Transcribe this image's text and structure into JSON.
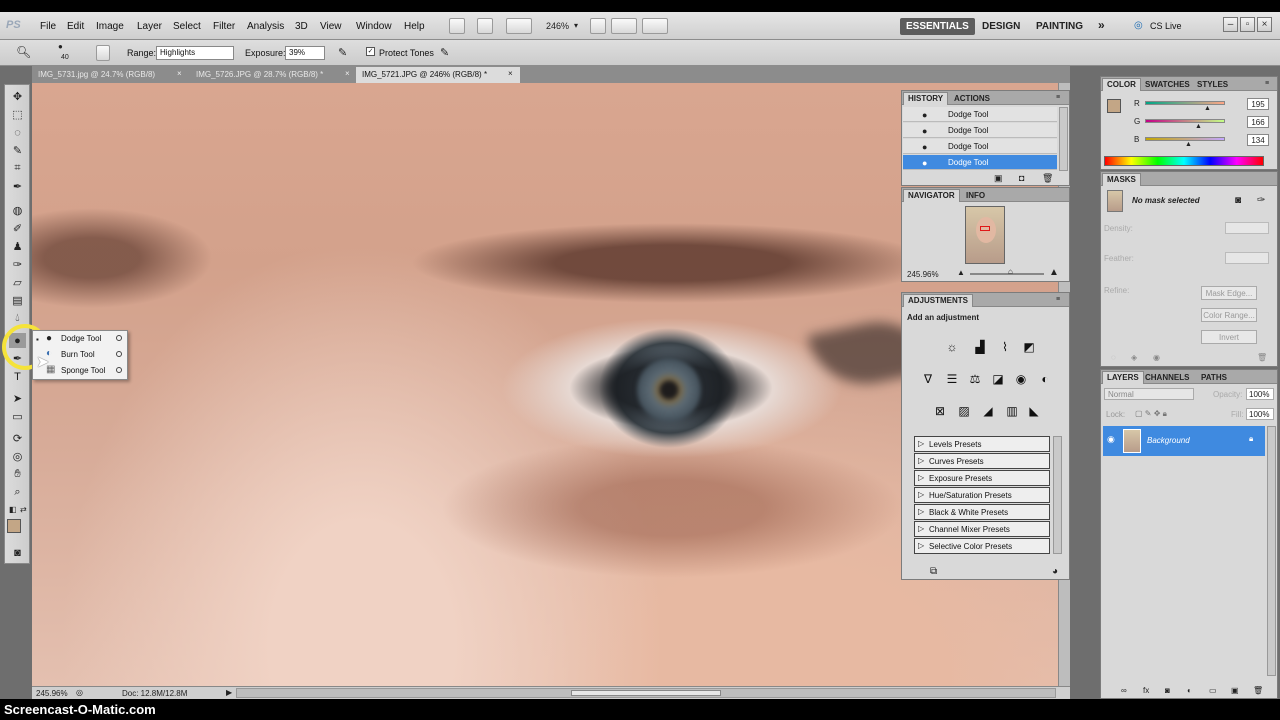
{
  "app": {
    "logo": "PS",
    "watermark": "Screencast-O-Matic.com"
  },
  "menu": [
    "File",
    "Edit",
    "Image",
    "Layer",
    "Select",
    "Filter",
    "Analysis",
    "3D",
    "View",
    "Window",
    "Help"
  ],
  "appbar": {
    "zoom": "246%",
    "workspaces": [
      "ESSENTIALS",
      "DESIGN",
      "PAINTING"
    ],
    "more": "»",
    "cslive": "CS Live"
  },
  "options": {
    "brush_size": "40",
    "range_label": "Range:",
    "range_value": "Highlights",
    "exposure_label": "Exposure:",
    "exposure_value": "39%",
    "protect_tones": "Protect Tones"
  },
  "tabs": [
    "IMG_5731.jpg @ 24.7% (RGB/8)",
    "IMG_5726.JPG @ 28.7% (RGB/8) *",
    "IMG_5721.JPG @ 246% (RGB/8) *"
  ],
  "flyout": [
    "Dodge Tool",
    "Burn Tool",
    "Sponge Tool"
  ],
  "status": {
    "zoom": "245.96%",
    "doc": "Doc: 12.8M/12.8M"
  },
  "history": {
    "tabs": [
      "HISTORY",
      "ACTIONS"
    ],
    "rows": [
      "Dodge Tool",
      "Dodge Tool",
      "Dodge Tool",
      "Dodge Tool"
    ]
  },
  "navigator": {
    "tabs": [
      "NAVIGATOR",
      "INFO"
    ],
    "zoom": "245.96%"
  },
  "adjustments": {
    "tab": "ADJUSTMENTS",
    "heading": "Add an adjustment",
    "presets": [
      "Levels Presets",
      "Curves Presets",
      "Exposure Presets",
      "Hue/Saturation Presets",
      "Black & White Presets",
      "Channel Mixer Presets",
      "Selective Color Presets"
    ]
  },
  "color": {
    "tabs": [
      "COLOR",
      "SWATCHES",
      "STYLES"
    ],
    "channels": [
      {
        "label": "R",
        "value": "195"
      },
      {
        "label": "G",
        "value": "166"
      },
      {
        "label": "B",
        "value": "134"
      }
    ],
    "swatch": "#c3a686"
  },
  "masks": {
    "tab": "MASKS",
    "status": "No mask selected",
    "density": "Density:",
    "feather": "Feather:",
    "refine": "Refine:",
    "buttons": [
      "Mask Edge...",
      "Color Range...",
      "Invert"
    ]
  },
  "layers": {
    "tabs": [
      "LAYERS",
      "CHANNELS",
      "PATHS"
    ],
    "blend": "Normal",
    "opacity_label": "Opacity:",
    "opacity": "100%",
    "lock_label": "Lock:",
    "fill_label": "Fill:",
    "fill": "100%",
    "layer_name": "Background"
  }
}
